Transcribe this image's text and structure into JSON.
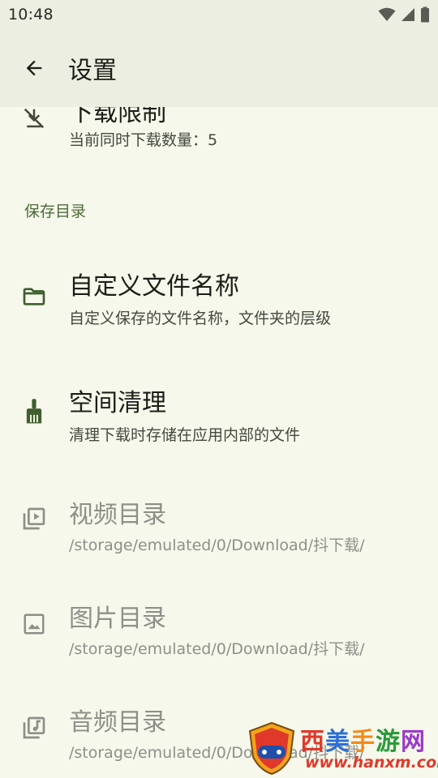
{
  "status_bar": {
    "time": "10:48"
  },
  "app_bar": {
    "title": "设置"
  },
  "download_limit": {
    "title": "下载限制",
    "summary": "当前同时下载数量：5"
  },
  "section": {
    "save_dir": "保存目录"
  },
  "items": {
    "custom_name": {
      "title": "自定义文件名称",
      "summary": "自定义保存的文件名称，文件夹的层级"
    },
    "cleanup": {
      "title": "空间清理",
      "summary": "清理下载时存储在应用内部的文件"
    },
    "video_dir": {
      "title": "视频目录",
      "summary": "/storage/emulated/0/Download/抖下载/"
    },
    "image_dir": {
      "title": "图片目录",
      "summary": "/storage/emulated/0/Download/抖下载/"
    },
    "audio_dir": {
      "title": "音频目录",
      "summary": "/storage/emulated/0/Download/抖下载/"
    }
  },
  "watermark": {
    "c1": "西",
    "c2": "美",
    "c3": "手",
    "c4": "游",
    "c5": "网",
    "url": "www.hanxm.com"
  },
  "colors": {
    "accent": "#4c6a38",
    "background": "#f6f8ec",
    "appbar": "#ebeee0"
  },
  "icons": [
    "back-arrow",
    "download-off",
    "folder",
    "broom",
    "video-library",
    "image",
    "music-library"
  ]
}
